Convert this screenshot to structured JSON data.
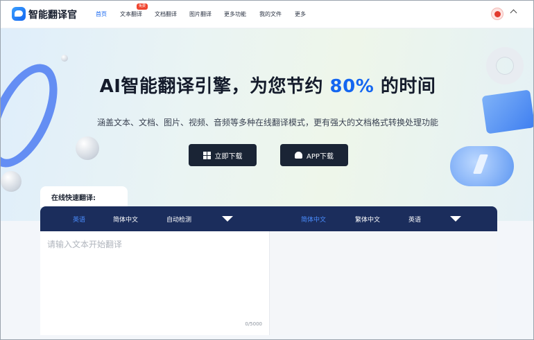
{
  "header": {
    "brand": "智能翻译官",
    "nav": [
      "首页",
      "文本翻译",
      "文档翻译",
      "图片翻译",
      "更多功能",
      "我的文件",
      "更多"
    ],
    "badge": "免费",
    "active_color": "#1466f0"
  },
  "hero": {
    "headline_pre": "AI智能翻译引擎，为您节约 ",
    "headline_highlight": "80%",
    "headline_post": " 的时间",
    "subtitle": "涵盖文本、文档、图片、视频、音频等多种在线翻译模式，更有强大的文档格式转换处理功能",
    "buttons": [
      "立即下载",
      "APP下载"
    ]
  },
  "translate": {
    "tab_title": "在线快速翻译:",
    "source_langs": [
      "英语",
      "简体中文",
      "自动检测"
    ],
    "target_langs": [
      "简体中文",
      "繁体中文",
      "英语"
    ],
    "input_placeholder": "请输入文本开始翻译",
    "char_count": "0/5000",
    "bar_color": "#1b2d5c"
  },
  "icons": [
    "logo-icon",
    "avatar-icon",
    "chevron-up-icon",
    "windows-icon",
    "android-icon",
    "dropdown-triangle-icon"
  ]
}
